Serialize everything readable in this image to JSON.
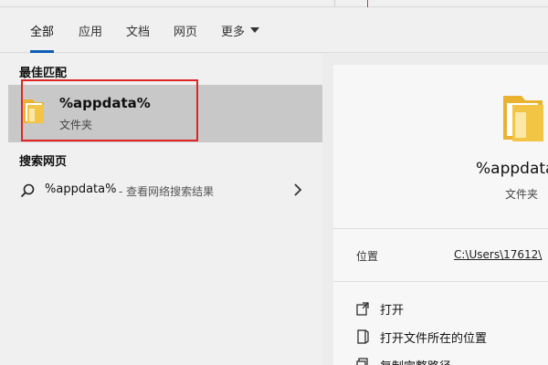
{
  "tabs": {
    "all": "全部",
    "apps": "应用",
    "docs": "文档",
    "web": "网页",
    "more": "更多"
  },
  "sections": {
    "best_match": "最佳匹配",
    "web_search": "搜索网页"
  },
  "best_match": {
    "title": "%appdata%",
    "type": "文件夹"
  },
  "web_result": {
    "query": "%appdata%",
    "suffix": "- 查看网络搜索结果"
  },
  "preview": {
    "title": "%appdata",
    "type": "文件夹",
    "location_label": "位置",
    "location_value": "C:\\Users\\17612\\"
  },
  "actions": {
    "open": "打开",
    "open_location": "打开文件所在的位置",
    "copy_path": "复制完整路径"
  },
  "colors": {
    "tab_active": "#0a5fb4",
    "highlight_box": "#e02424",
    "selected_row": "#c8c8c8",
    "folder_yellow": "#f3c544"
  },
  "icons": [
    "folder-icon",
    "search-icon",
    "chevron-down-icon",
    "chevron-right-icon",
    "open-icon",
    "open-location-icon",
    "copy-icon"
  ]
}
